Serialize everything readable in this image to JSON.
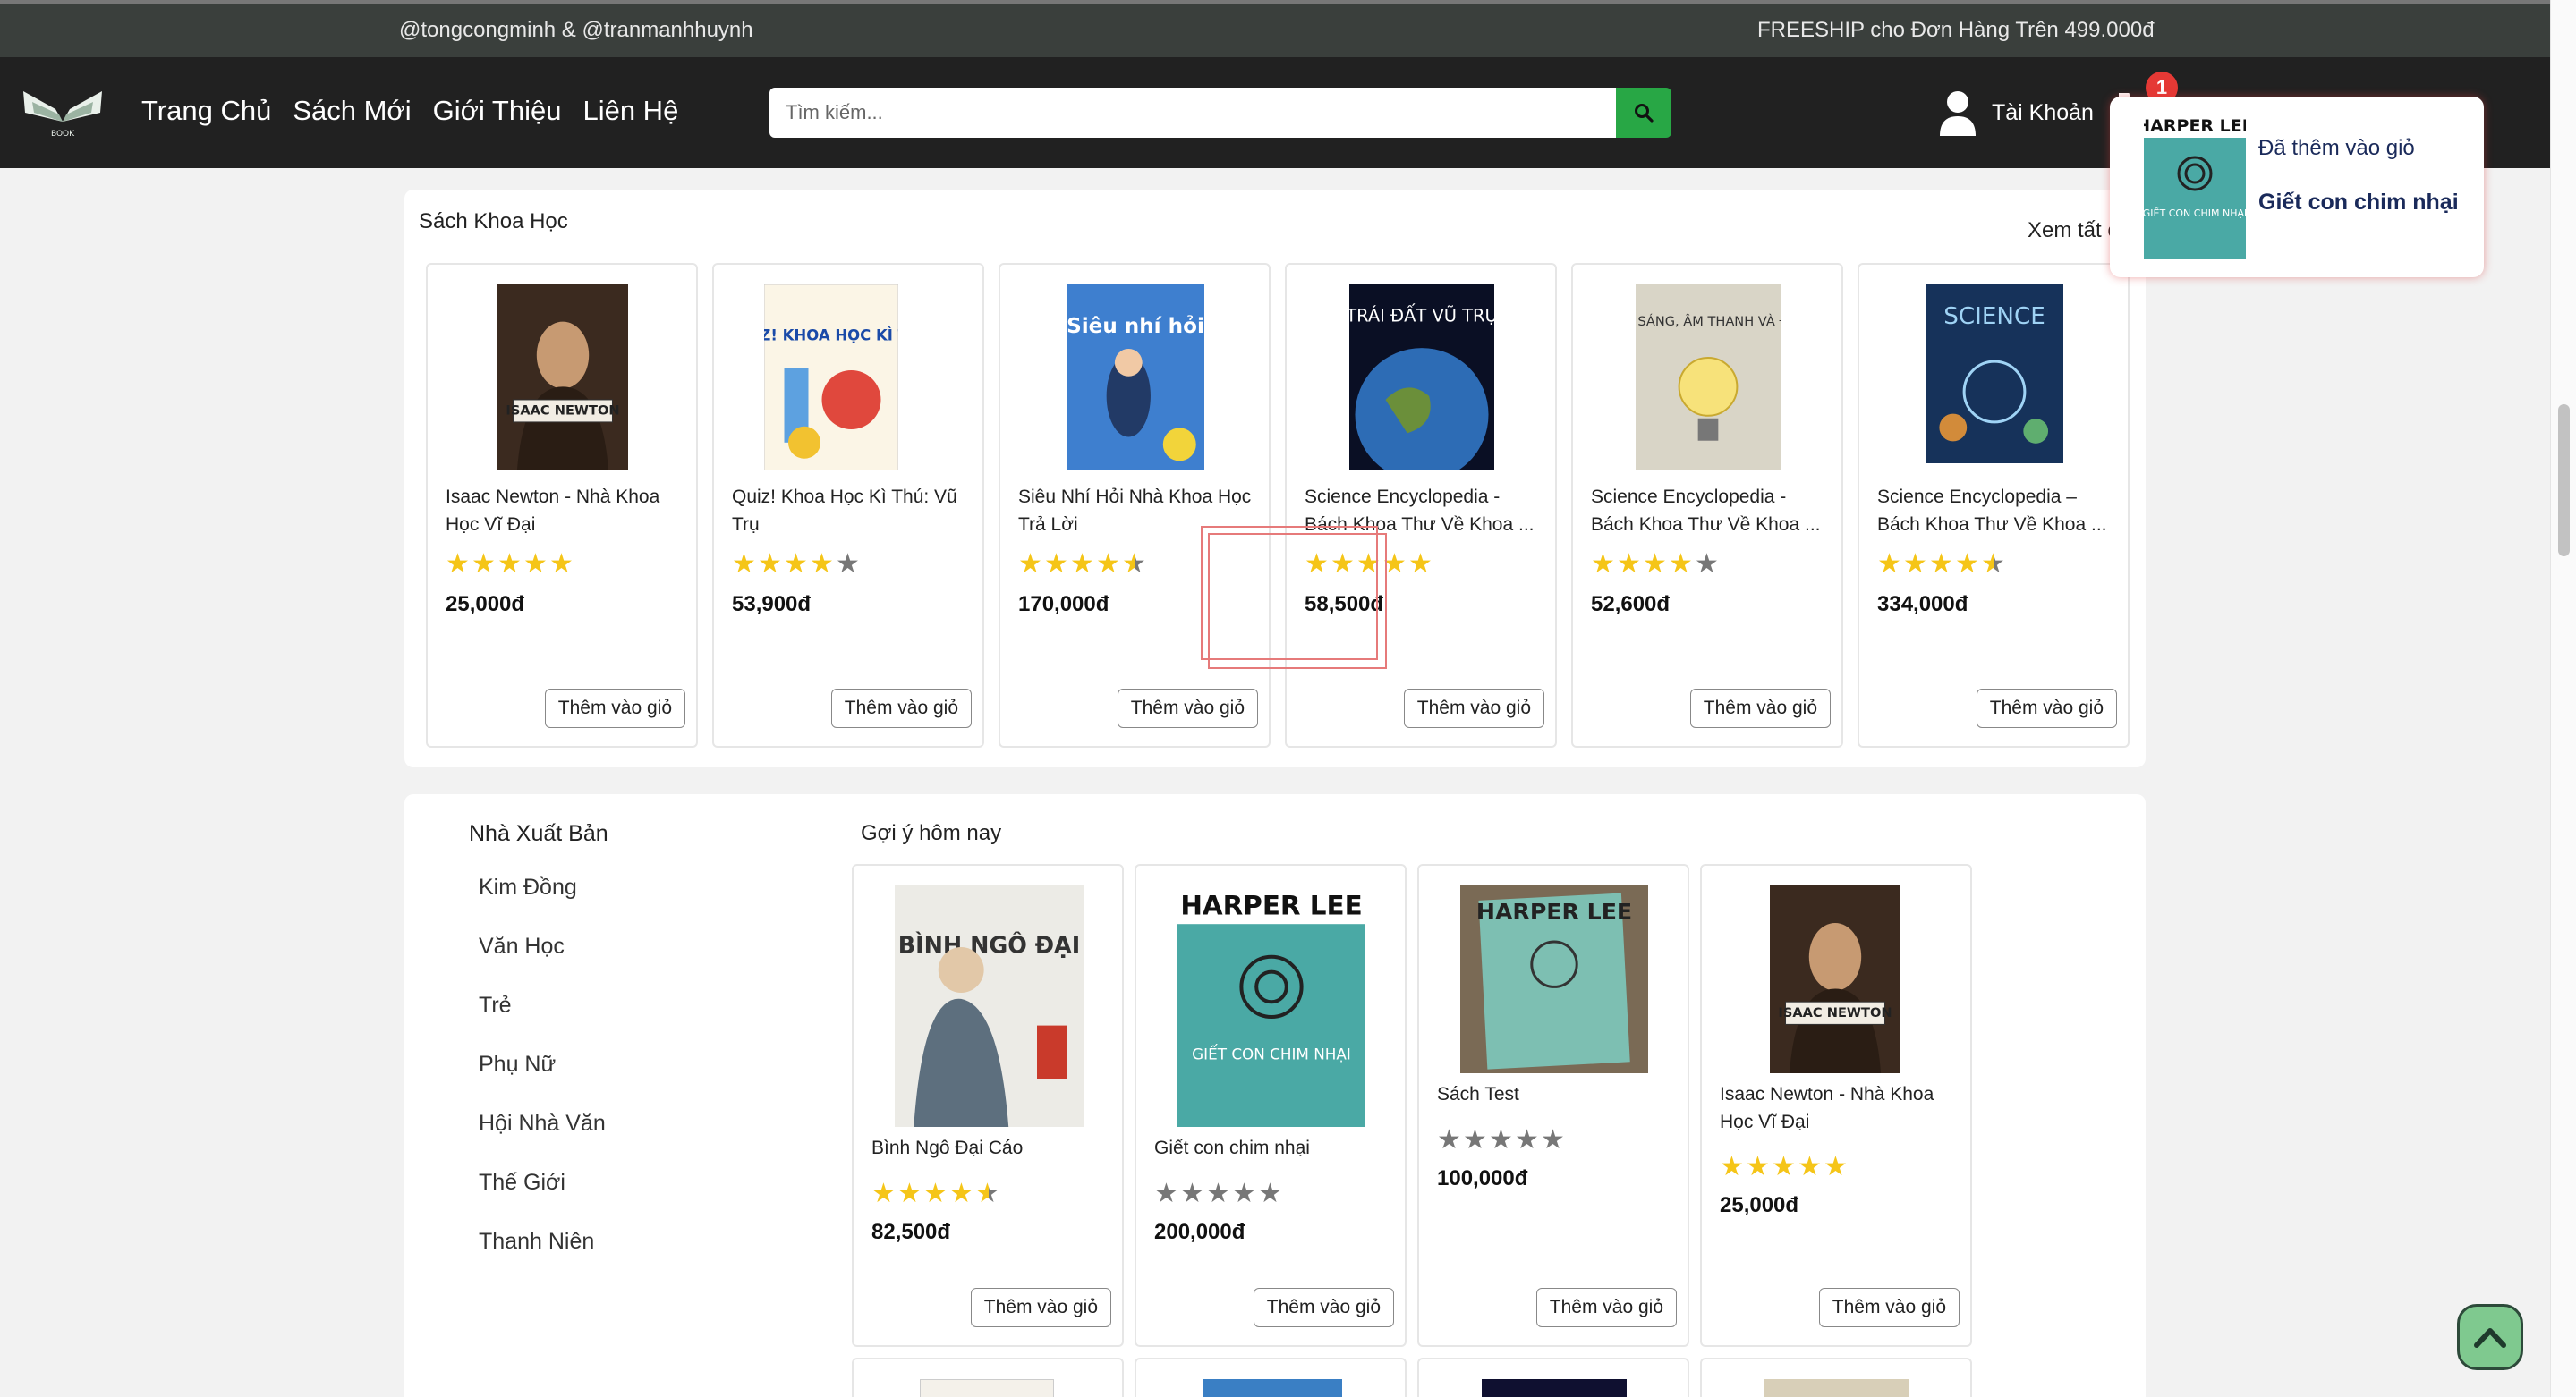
{
  "topbar": {
    "authors": "@tongcongminh & @tranmanhhuynh",
    "promo": "FREESHIP cho Đơn Hàng Trên 499.000đ"
  },
  "navbar": {
    "logo_text": "BOOK",
    "links": [
      "Trang Chủ",
      "Sách Mới",
      "Giới Thiệu",
      "Liên Hệ"
    ],
    "search_placeholder": "Tìm kiếm...",
    "account_label": "Tài Khoản",
    "cart_count": "1"
  },
  "science_section": {
    "title": "Sách Khoa Học",
    "see_all": "Xem tất c",
    "products": [
      {
        "title": "Isaac Newton - Nhà Khoa Học Vĩ Đại",
        "rating": 5,
        "price": "25,000đ",
        "button": "Thêm vào giỏ",
        "cover": "isaac-newton"
      },
      {
        "title": "Quiz! Khoa Học Kì Thú: Vũ Trụ",
        "rating": 4,
        "price": "53,900đ",
        "button": "Thêm vào giỏ",
        "cover": "quiz"
      },
      {
        "title": "Siêu Nhí Hỏi Nhà Khoa Học Trả Lời",
        "rating": 4.5,
        "price": "170,000đ",
        "button": "Thêm vào giỏ",
        "cover": "sieu-nhi"
      },
      {
        "title": "Science Encyclopedia - Bách Khoa Thư Về Khoa ...",
        "rating": 5,
        "price": "58,500đ",
        "button": "Thêm vào giỏ",
        "cover": "trai-dat"
      },
      {
        "title": "Science Encyclopedia - Bách Khoa Thư Về Khoa ...",
        "rating": 4,
        "price": "52,600đ",
        "button": "Thêm vào giỏ",
        "cover": "anh-sang"
      },
      {
        "title": "Science Encyclopedia – Bách Khoa Thư Về Khoa ...",
        "rating": 4.5,
        "price": "334,000đ",
        "button": "Thêm vào giỏ",
        "cover": "science"
      }
    ]
  },
  "publishers": {
    "title": "Nhà Xuất Bản",
    "items": [
      "Kim Đồng",
      "Văn Học",
      "Trẻ",
      "Phụ Nữ",
      "Hội Nhà Văn",
      "Thế Giới",
      "Thanh Niên"
    ]
  },
  "suggestions": {
    "title": "Gợi ý hôm nay",
    "products": [
      {
        "title": "Bình Ngô Đại Cáo",
        "rating": 4.5,
        "price": "82,500đ",
        "button": "Thêm vào giỏ",
        "cover": "binh-ngo"
      },
      {
        "title": "Giết con chim nhại",
        "rating": 0,
        "price": "200,000đ",
        "button": "Thêm vào giỏ",
        "cover": "harper-lee"
      },
      {
        "title": "Sách Test",
        "rating": 0,
        "price": "100,000đ",
        "button": "Thêm vào giỏ",
        "cover": "harper-lee-photo"
      },
      {
        "title": "Isaac Newton - Nhà Khoa Học Vĩ Đại",
        "rating": 5,
        "price": "25,000đ",
        "button": "Thêm vào giỏ",
        "cover": "isaac-newton"
      }
    ]
  },
  "cover_text": {
    "binh_ngo": "BÌNH NGÔ ĐẠI CÁO",
    "harper_lee": "HARPER LEE",
    "giet_con_chim_nhai": "GIẾT CON CHIM NHẠI",
    "isaac_newton": "ISAAC NEWTON",
    "quiz": "QUIZ! KHOA HỌC KÌ THÚ",
    "sieu_nhi_hoi": "Siêu nhí hỏi",
    "trai_dat": "TRÁI ĐẤT VŨ TRỤ",
    "anh_sang": "ÁNH SÁNG, ÂM THANH VÀ ĐIỆN",
    "science": "SCIENCE"
  },
  "toast": {
    "message": "Đã thêm vào giỏ",
    "product": "Giết con chim nhại"
  },
  "colors": {
    "topbar": "#3a3f3c",
    "navbar": "#212121",
    "search_button": "#28a745",
    "star": "#f5c518",
    "badge": "#e53935"
  }
}
